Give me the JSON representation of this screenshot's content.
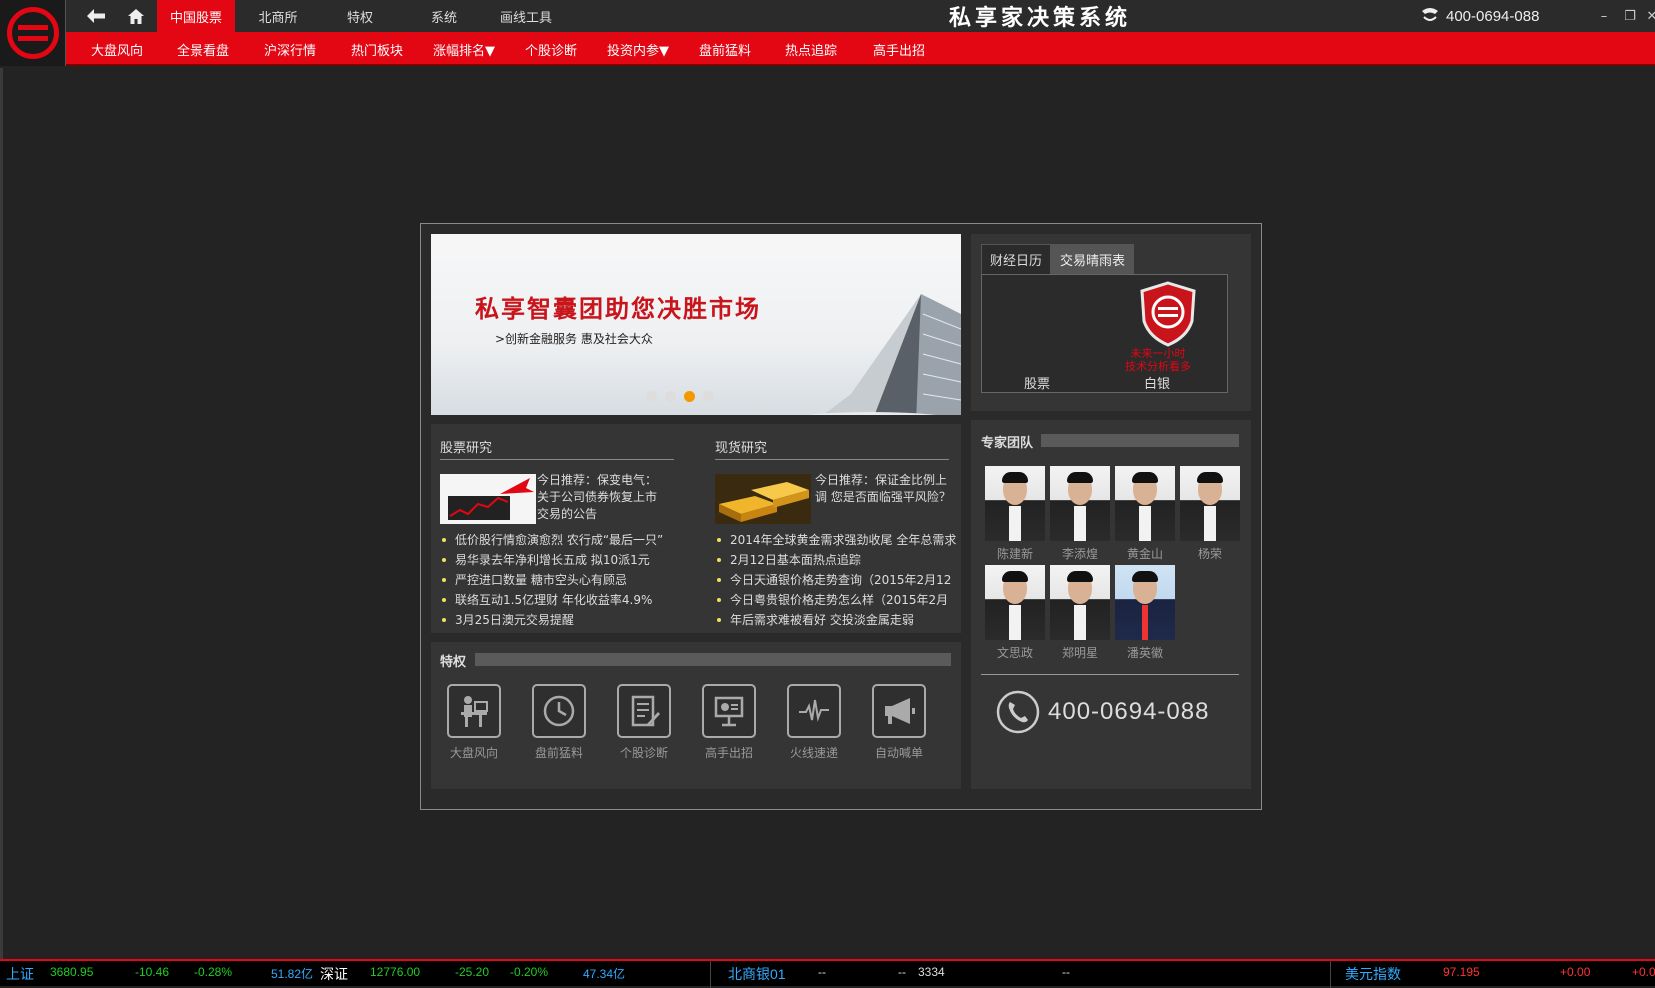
{
  "topbar": {
    "tabs": [
      "中国股票",
      "北商所",
      "特权",
      "系统",
      "画线工具"
    ],
    "active_tab": 0,
    "app_title": "私享家决策系统",
    "phone": "400-0694-088"
  },
  "subnav": [
    "大盘风向",
    "全景看盘",
    "沪深行情",
    "热门板块",
    "涨幅排名▼",
    "个股诊断",
    "投资内参▼",
    "盘前猛料",
    "热点追踪",
    "高手出招"
  ],
  "banner": {
    "title": "私享智囊团助您决胜市场",
    "subtitle": ">创新金融服务 惠及社会大众"
  },
  "stock_research": {
    "title": "股票研究",
    "featured": "今日推荐：保变电气：关于公司债券恢复上市交易的公告",
    "items": [
      "低价股行情愈演愈烈 农行成“最后一只”",
      "易华录去年净利增长五成 拟10派1元",
      "严控进口数量 糖市空头心有顾忌",
      "联络互动1.5亿理财 年化收益率4.9%",
      "3月25日澳元交易提醒"
    ]
  },
  "spot_research": {
    "title": "现货研究",
    "featured": "今日推荐：保证金比例上调 您是否面临强平风险？",
    "items": [
      "2014年全球黄金需求强劲收尾 全年总需求",
      "2月12日基本面热点追踪",
      "今日天通银价格走势查询（2015年2月12",
      "今日粤贵银价格走势怎么样（2015年2月",
      "年后需求难被看好 交投淡金属走弱"
    ]
  },
  "privileges": {
    "title": "特权",
    "items": [
      "大盘风向",
      "盘前猛料",
      "个股诊断",
      "高手出招",
      "火线速递",
      "自动喊单"
    ]
  },
  "calendar": {
    "tabs": [
      "财经日历",
      "交易晴雨表"
    ],
    "active_tab": 1,
    "col1": "股票",
    "col2": "白银",
    "note1": "未来一小时",
    "note2": "技术分析看多"
  },
  "experts": {
    "title": "专家团队",
    "names": [
      "陈建新",
      "李添煌",
      "黄金山",
      "杨荣",
      "文思政",
      "郑明星",
      "潘英徽"
    ]
  },
  "contact": {
    "phone": "400-0694-088"
  },
  "ticker": {
    "sh_label": "上证",
    "sh_value": "3680.95",
    "sh_change": "-10.46",
    "sh_pct": "-0.28%",
    "sh_volume": "51.82亿",
    "sz_label": "深证",
    "sz_value": "12776.00",
    "sz_change": "-25.20",
    "sz_pct": "-0.20%",
    "sz_volume": "47.34亿",
    "silver_label": "北商银01",
    "silver_a": "--",
    "silver_b": "--",
    "silver_c": "3334",
    "silver_d": "--",
    "usd_label": "美元指数",
    "usd_value": "97.195",
    "usd_change": "+0.00",
    "usd_pct": "+0.0"
  },
  "colors": {
    "brand_red": "#e30613",
    "accent_orange": "#f39800",
    "up_red": "#ff3333",
    "down_green": "#22cc22",
    "ticker_blue": "#33aaff"
  }
}
